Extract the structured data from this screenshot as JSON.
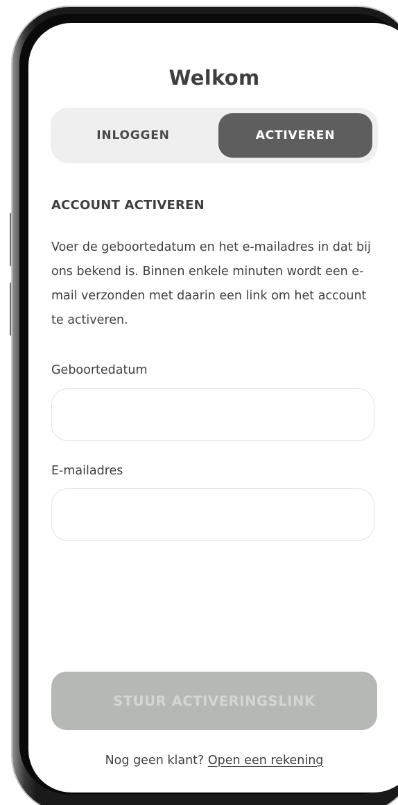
{
  "title": "Welkom",
  "tabs": {
    "login_label": "INLOGGEN",
    "activate_label": "ACTIVEREN"
  },
  "section": {
    "heading": "ACCOUNT ACTIVEREN",
    "instructions": "Voer de geboortedatum en het e-mailadres in dat bij ons bekend is. Binnen enkele minuten wordt een e-mail verzonden met daarin een link om het account te activeren."
  },
  "form": {
    "birthdate_label": "Geboortedatum",
    "birthdate_value": "",
    "email_label": "E-mailadres",
    "email_value": ""
  },
  "submit": {
    "label": "STUUR ACTIVERINGSLINK"
  },
  "footer": {
    "prompt": "Nog geen klant?",
    "link_label": "Open een rekening"
  },
  "colors": {
    "active_tab_bg": "#5e5e5e",
    "segmented_bg": "#efefef",
    "disabled_button_bg": "#b5b8b4",
    "text": "#3f3f3f"
  }
}
